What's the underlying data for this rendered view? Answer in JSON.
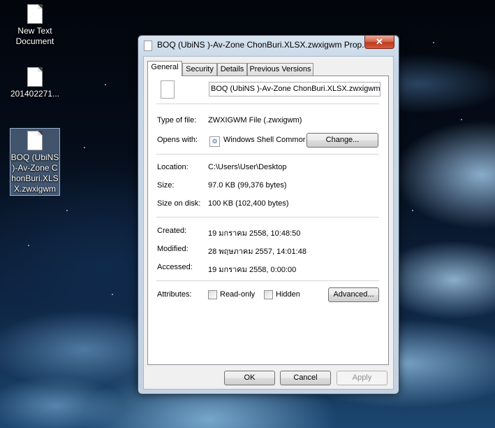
{
  "desktop": {
    "icons": [
      {
        "label": "New Text Document",
        "selected": false
      },
      {
        "label": "20140227​1...",
        "selected": false
      },
      {
        "label": "BOQ (UbiNS )-Av-Zone ChonBuri.XLSX.zwxigwm",
        "selected": true
      }
    ]
  },
  "window": {
    "title": "BOQ (UbiNS )-Av-Zone ChonBuri.XLSX.zwxigwm Prop...",
    "close_glyph": "✕",
    "tabs": [
      "General",
      "Security",
      "Details",
      "Previous Versions"
    ],
    "active_tab": "General",
    "general": {
      "file_name": "BOQ (UbiNS )-Av-Zone ChonBuri.XLSX.zwxigwm",
      "type_label": "Type of file:",
      "type_value": "ZWXIGWM File (.zwxigwm)",
      "opens_label": "Opens with:",
      "opens_value": "Windows Shell Commor",
      "change_button": "Change...",
      "location_label": "Location:",
      "location_value": "C:\\Users\\User\\Desktop",
      "size_label": "Size:",
      "size_value": "97.0 KB (99,376 bytes)",
      "size_on_disk_label": "Size on disk:",
      "size_on_disk_value": "100 KB (102,400 bytes)",
      "created_label": "Created:",
      "created_value": "19 มกราคม 2558, 10:48:50",
      "modified_label": "Modified:",
      "modified_value": "28 พฤษภาคม 2557, 14:01:48",
      "accessed_label": "Accessed:",
      "accessed_value": "19 มกราคม 2558, 0:00:00",
      "attributes_label": "Attributes:",
      "readonly_label": "Read-only",
      "hidden_label": "Hidden",
      "advanced_button": "Advanced..."
    },
    "buttons": {
      "ok": "OK",
      "cancel": "Cancel",
      "apply": "Apply"
    }
  },
  "colors": {
    "close_red": "#c1381c",
    "frame_blue": "#c8d7e7"
  }
}
